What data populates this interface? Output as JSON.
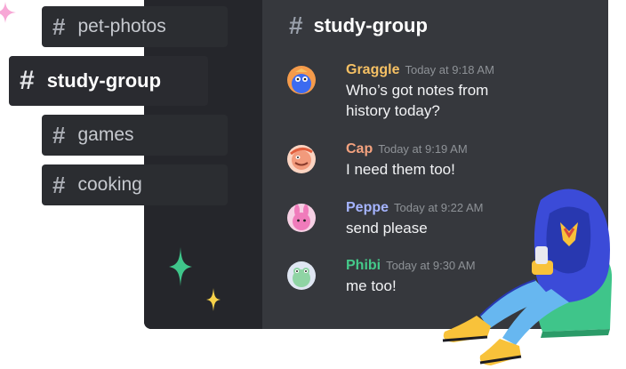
{
  "channels": [
    {
      "name": "pet-photos",
      "active": false
    },
    {
      "name": "study-group",
      "active": true
    },
    {
      "name": "games",
      "active": false
    },
    {
      "name": "cooking",
      "active": false
    }
  ],
  "chat": {
    "channel_name": "study-group",
    "messages": [
      {
        "author": "Graggle",
        "time": "Today at 9:18 AM",
        "text_line1": "Who’s got notes from",
        "text_line2": "history today?",
        "author_color": "#f5c064"
      },
      {
        "author": "Cap",
        "time": "Today at 9:19 AM",
        "text_line1": "I need them too!",
        "author_color": "#f4a27f"
      },
      {
        "author": "Peppe",
        "time": "Today at 9:22 AM",
        "text_line1": "send please",
        "author_color": "#a5b4ff"
      },
      {
        "author": "Phibi",
        "time": "Today at 9:30 AM",
        "text_line1": "me too!",
        "author_color": "#44c98a"
      }
    ]
  },
  "icons": {
    "hash": "#",
    "sparkles": [
      "sparkle-pink-icon",
      "sparkle-green-icon",
      "sparkle-yellow-icon"
    ],
    "character": "hooded-character-illustration"
  },
  "colors": {
    "window_bg": "#36383d",
    "rail_bg": "#25262b",
    "pill_bg": "#2b2d31",
    "brand_blue": "#4752ff"
  }
}
